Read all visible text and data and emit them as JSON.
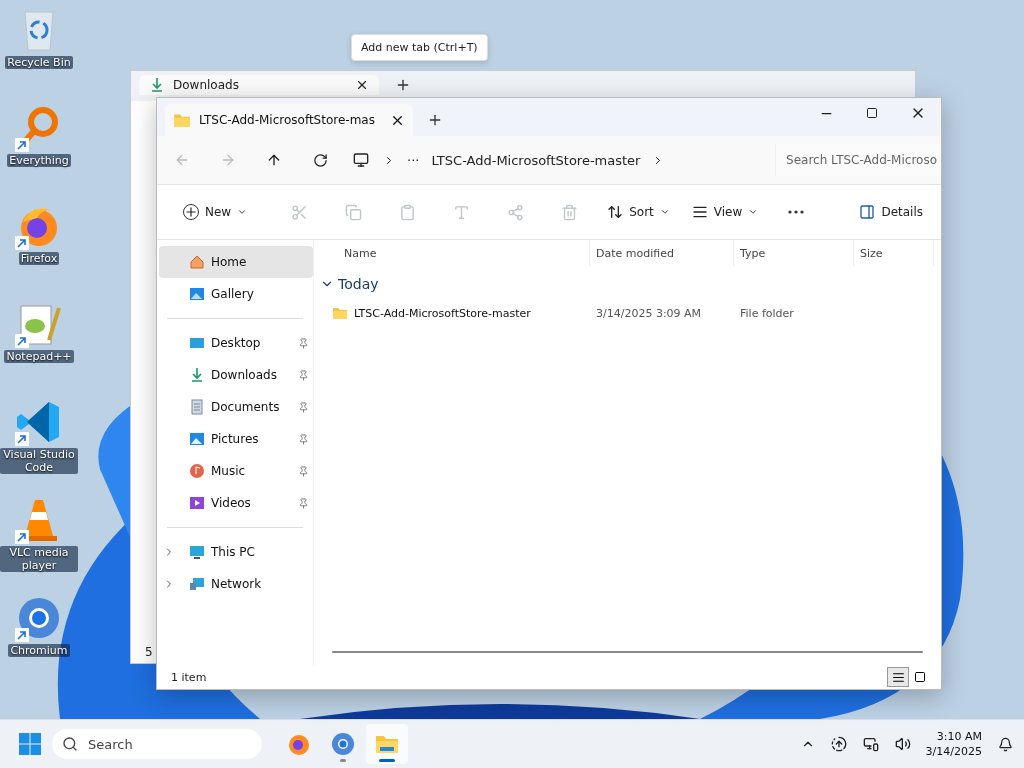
{
  "desktop_icons": [
    {
      "label": "Recycle Bin",
      "shortcut": false
    },
    {
      "label": "Everything",
      "shortcut": true
    },
    {
      "label": "Firefox",
      "shortcut": true
    },
    {
      "label": "Notepad++",
      "shortcut": true
    },
    {
      "label": "Visual Studio Code",
      "shortcut": true
    },
    {
      "label": "VLC media player",
      "shortcut": true
    },
    {
      "label": "Chromium",
      "shortcut": true
    }
  ],
  "tooltip": "Add new tab (Ctrl+T)",
  "back_window": {
    "tab": "Downloads",
    "status": "5"
  },
  "window": {
    "tabs": [
      {
        "label": "LTSC-Add-MicrosoftStore-mas",
        "selected": true
      }
    ],
    "address": {
      "overflow": "···",
      "crumb": "LTSC-Add-MicrosoftStore-master"
    },
    "search": {
      "placeholder": "Search LTSC-Add-Microso"
    },
    "new_button": "New",
    "icon_buttons": [
      {
        "disabled": true
      },
      {
        "disabled": true
      },
      {
        "disabled": true
      },
      {
        "disabled": true
      },
      {
        "disabled": true
      },
      {
        "disabled": true
      }
    ],
    "sort_button": "Sort",
    "view_button": "View",
    "details_button": "Details",
    "sidebar": [
      {
        "items": [
          {
            "label": "Home",
            "selected": true
          },
          {
            "label": "Gallery",
            "selected": false
          }
        ]
      },
      {
        "items": [
          {
            "label": "Desktop",
            "selected": false,
            "pinned": true
          },
          {
            "label": "Downloads",
            "selected": false,
            "pinned": true
          },
          {
            "label": "Documents",
            "selected": false,
            "pinned": true
          },
          {
            "label": "Pictures",
            "selected": false,
            "pinned": true
          },
          {
            "label": "Music",
            "selected": false,
            "pinned": true
          },
          {
            "label": "Videos",
            "selected": false,
            "pinned": true
          }
        ]
      },
      {
        "items": [
          {
            "label": "This PC",
            "selected": false,
            "expanded": false
          },
          {
            "label": "Network",
            "selected": false,
            "expanded": false
          }
        ]
      }
    ],
    "columns": [
      "Name",
      "Date modified",
      "Type",
      "Size"
    ],
    "groups": [
      {
        "label": "Today",
        "expanded": true,
        "rows": [
          {
            "name": "LTSC-Add-MicrosoftStore-master",
            "date": "3/14/2025 3:09 AM",
            "type": "File folder",
            "selected": false
          }
        ]
      }
    ],
    "status": "1 item",
    "view_modes": [
      {
        "selected": true
      },
      {
        "selected": false
      }
    ]
  },
  "taskbar": {
    "search": {
      "placeholder": "Search"
    },
    "apps": [
      {
        "running": false,
        "active": false
      },
      {
        "running": true,
        "active": false
      },
      {
        "running": true,
        "active": true
      }
    ],
    "time": "3:10 AM",
    "date": "3/14/2025"
  }
}
